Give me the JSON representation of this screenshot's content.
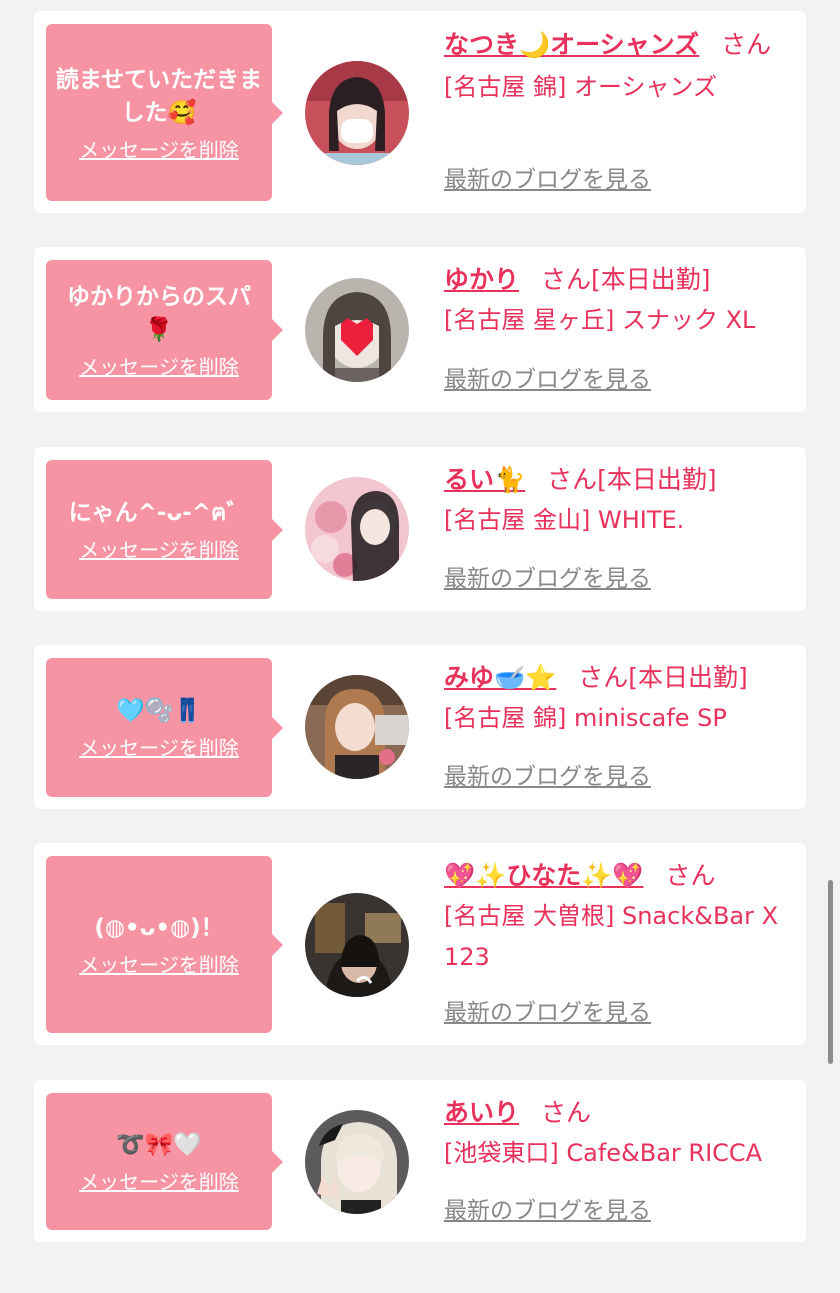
{
  "cards": [
    {
      "message": "読ませていただきました🥰",
      "delete_label": "メッセージを削除",
      "name": "なつき🌙オーシャンズ",
      "honorific": "さん",
      "status": "",
      "shop": "[名古屋 錦] オーシャンズ",
      "blog_label": "最新のブログを見る",
      "avatar_theme": "#c8505a"
    },
    {
      "message": "ゆかりからのスパ🌹",
      "delete_label": "メッセージを削除",
      "name": "ゆかり",
      "honorific": "さん",
      "status": "[本日出勤]",
      "shop": "[名古屋 星ヶ丘] スナック XL",
      "blog_label": "最新のブログを見る",
      "avatar_theme": "#b9b4ae"
    },
    {
      "message": "にゃん^-ᴗ-^ฅ゛",
      "delete_label": "メッセージを削除",
      "name": "るい🐈",
      "honorific": "さん",
      "status": "[本日出勤]",
      "shop": "[名古屋 金山] WHITE.",
      "blog_label": "最新のブログを見る",
      "avatar_theme": "#f2c6cf"
    },
    {
      "message": "🩵🫧👖",
      "delete_label": "メッセージを削除",
      "name": "みゆ🥣⭐",
      "honorific": "さん",
      "status": "[本日出勤]",
      "shop": "[名古屋 錦] miniscafe SP",
      "blog_label": "最新のブログを見る",
      "avatar_theme": "#8a6a55"
    },
    {
      "message": "(◍•ᴗ•◍)！",
      "delete_label": "メッセージを削除",
      "name": "💖✨ひなた✨💖",
      "honorific": "さん",
      "status": "",
      "shop": "[名古屋 大曽根] Snack&Bar X 123",
      "blog_label": "最新のブログを見る",
      "avatar_theme": "#3a3430"
    },
    {
      "message": "➰🎀🤍",
      "delete_label": "メッセージを削除",
      "name": "あいり",
      "honorific": "さん",
      "status": "",
      "shop": "[池袋東口] Cafe&Bar RICCA",
      "blog_label": "最新のブログを見る",
      "avatar_theme": "#d8d2c8"
    }
  ],
  "colors": {
    "accent": "#e8315b",
    "bubble": "#f794a4",
    "card_bg": "#ffffff",
    "page_bg": "#f2f2f2",
    "muted_link": "#888888"
  }
}
